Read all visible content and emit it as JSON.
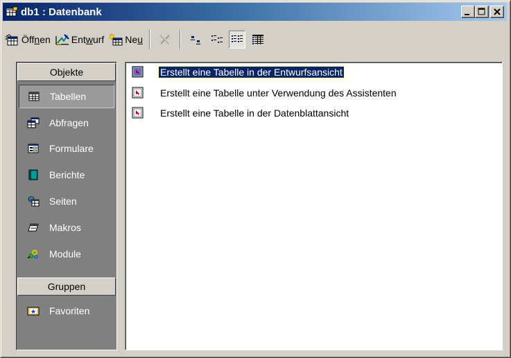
{
  "window": {
    "title": "db1 : Datenbank",
    "colors": {
      "titlebar_start": "#0a246a",
      "titlebar_end": "#a6caf0",
      "objbar": "#808080",
      "selection": "#0a246a"
    }
  },
  "toolbar": {
    "open_pre": "Öff",
    "open_key": "n",
    "open_post": "en",
    "design_pre": "Ent",
    "design_key": "w",
    "design_post": "urf",
    "new_pre": "Ne",
    "new_key": "u",
    "icons": [
      "delete-icon",
      "large-icons-view-icon",
      "small-icons-view-icon",
      "list-view-icon",
      "details-view-icon"
    ]
  },
  "sidebar": {
    "objects_header": "Objekte",
    "items": [
      {
        "label": "Tabellen",
        "icon": "table-icon",
        "selected": true
      },
      {
        "label": "Abfragen",
        "icon": "query-icon",
        "selected": false
      },
      {
        "label": "Formulare",
        "icon": "form-icon",
        "selected": false
      },
      {
        "label": "Berichte",
        "icon": "report-icon",
        "selected": false
      },
      {
        "label": "Seiten",
        "icon": "page-icon",
        "selected": false
      },
      {
        "label": "Makros",
        "icon": "macro-icon",
        "selected": false
      },
      {
        "label": "Module",
        "icon": "module-icon",
        "selected": false
      }
    ],
    "groups_header": "Gruppen",
    "groups": [
      {
        "label": "Favoriten",
        "icon": "favorites-folder-icon"
      }
    ]
  },
  "list": {
    "items": [
      {
        "label": "Erstellt eine Tabelle in der Entwurfsansicht",
        "selected": true
      },
      {
        "label": "Erstellt eine Tabelle unter Verwendung des Assistenten",
        "selected": false
      },
      {
        "label": "Erstellt eine Tabelle in der Datenblattansicht",
        "selected": false
      }
    ]
  }
}
